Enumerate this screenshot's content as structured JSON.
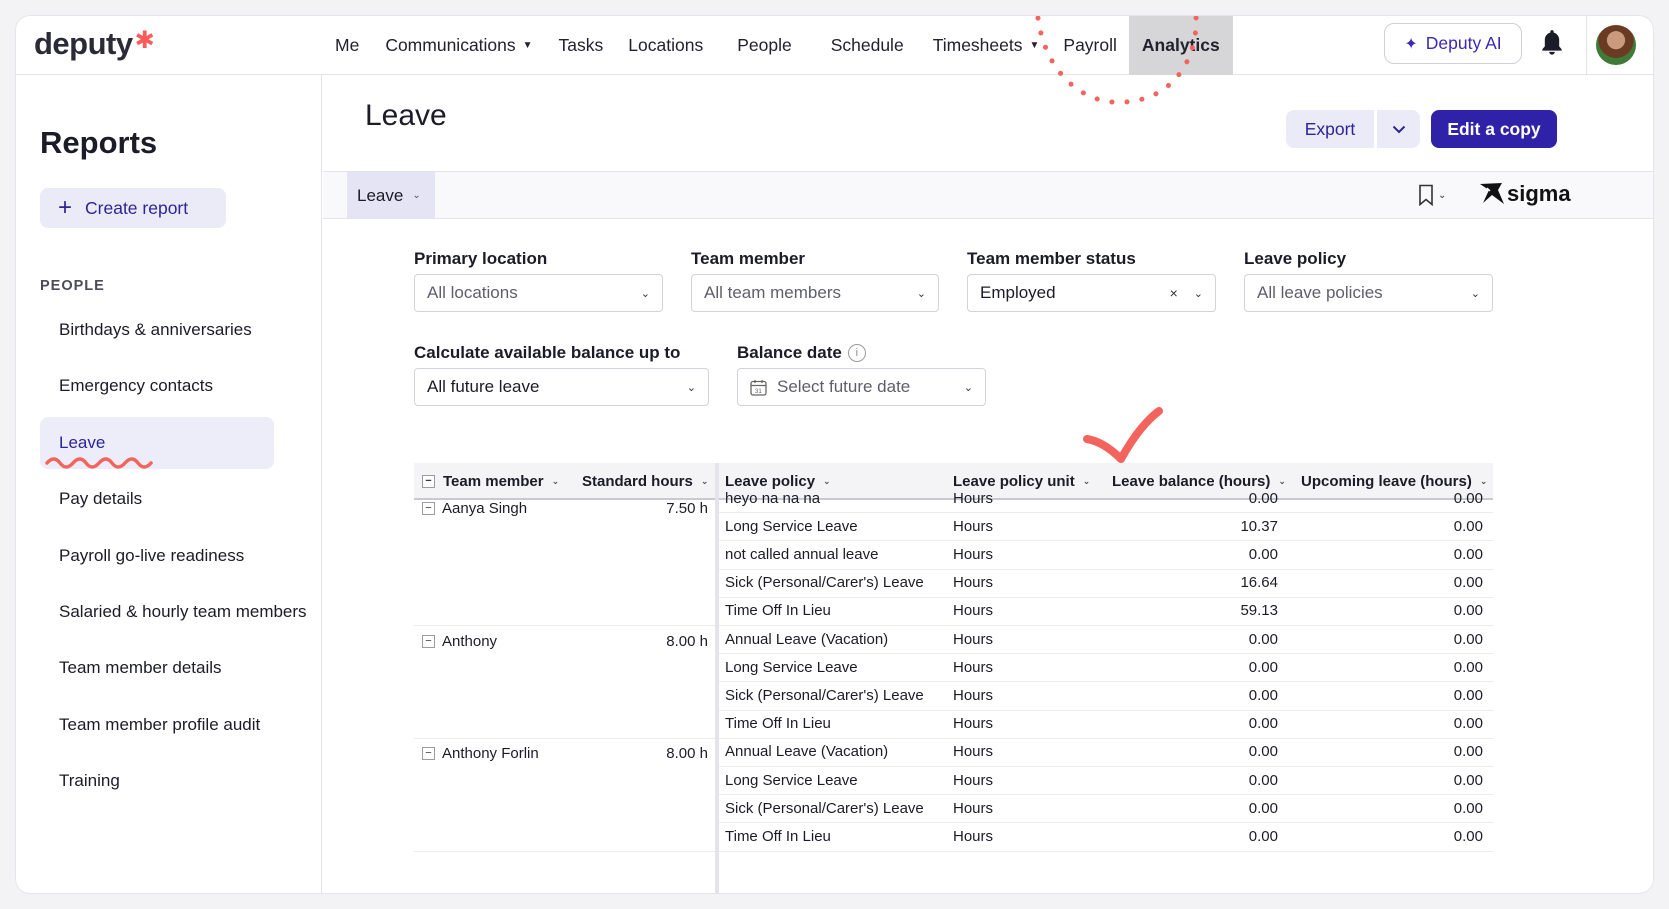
{
  "brand": {
    "logo_text": "deputy",
    "logo_mark": "✱"
  },
  "nav": {
    "items": [
      {
        "label": "Me",
        "caret": false,
        "active": false
      },
      {
        "label": "Communications",
        "caret": true,
        "active": false
      },
      {
        "label": "Tasks",
        "caret": false,
        "active": false
      },
      {
        "label": "Locations",
        "caret": false,
        "active": false
      },
      {
        "label": "People",
        "caret": false,
        "active": false
      },
      {
        "label": "Schedule",
        "caret": false,
        "active": false
      },
      {
        "label": "Timesheets",
        "caret": true,
        "active": false
      },
      {
        "label": "Payroll",
        "caret": false,
        "active": false
      },
      {
        "label": "Analytics",
        "caret": false,
        "active": true
      }
    ],
    "ai_button": "Deputy AI"
  },
  "sidebar": {
    "title": "Reports",
    "create_button": "Create report",
    "section": "PEOPLE",
    "items": [
      {
        "label": "Birthdays & anniversaries"
      },
      {
        "label": "Emergency contacts"
      },
      {
        "label": "Leave",
        "active": true
      },
      {
        "label": "Pay details"
      },
      {
        "label": "Payroll go-live readiness"
      },
      {
        "label": "Salaried & hourly team members"
      },
      {
        "label": "Team member details"
      },
      {
        "label": "Team member profile audit"
      },
      {
        "label": "Training"
      }
    ]
  },
  "page": {
    "title": "Leave",
    "export_button": "Export",
    "edit_button": "Edit a copy",
    "embed_tab": "Leave",
    "embed_brand": "sigma"
  },
  "filters": {
    "primary_location": {
      "label": "Primary location",
      "value": "All locations"
    },
    "team_member": {
      "label": "Team member",
      "value": "All team members"
    },
    "team_member_status": {
      "label": "Team member status",
      "value": "Employed"
    },
    "leave_policy": {
      "label": "Leave policy",
      "value": "All leave policies"
    },
    "calc_balance": {
      "label": "Calculate available balance up to",
      "value": "All future leave"
    },
    "balance_date": {
      "label": "Balance date",
      "placeholder": "Select future date"
    }
  },
  "table": {
    "headers": {
      "team_member": "Team member",
      "standard_hours": "Standard hours",
      "leave_policy": "Leave policy",
      "leave_policy_unit": "Leave policy unit",
      "leave_balance": "Leave balance (hours)",
      "upcoming_leave": "Upcoming leave (hours)"
    },
    "groups": [
      {
        "member": "Aanya Singh",
        "standard_hours": "7.50 h",
        "rows": [
          {
            "policy": "heyo na na na",
            "unit": "Hours",
            "balance": "0.00",
            "upcoming": "0.00"
          },
          {
            "policy": "Long Service Leave",
            "unit": "Hours",
            "balance": "10.37",
            "upcoming": "0.00"
          },
          {
            "policy": "not called annual leave",
            "unit": "Hours",
            "balance": "0.00",
            "upcoming": "0.00"
          },
          {
            "policy": "Sick (Personal/Carer's) Leave",
            "unit": "Hours",
            "balance": "16.64",
            "upcoming": "0.00"
          },
          {
            "policy": "Time Off In Lieu",
            "unit": "Hours",
            "balance": "59.13",
            "upcoming": "0.00"
          }
        ]
      },
      {
        "member": "Anthony",
        "standard_hours": "8.00 h",
        "rows": [
          {
            "policy": "Annual Leave (Vacation)",
            "unit": "Hours",
            "balance": "0.00",
            "upcoming": "0.00"
          },
          {
            "policy": "Long Service Leave",
            "unit": "Hours",
            "balance": "0.00",
            "upcoming": "0.00"
          },
          {
            "policy": "Sick (Personal/Carer's) Leave",
            "unit": "Hours",
            "balance": "0.00",
            "upcoming": "0.00"
          },
          {
            "policy": "Time Off In Lieu",
            "unit": "Hours",
            "balance": "0.00",
            "upcoming": "0.00"
          }
        ]
      },
      {
        "member": "Anthony Forlin",
        "standard_hours": "8.00 h",
        "rows": [
          {
            "policy": "Annual Leave (Vacation)",
            "unit": "Hours",
            "balance": "0.00",
            "upcoming": "0.00"
          },
          {
            "policy": "Long Service Leave",
            "unit": "Hours",
            "balance": "0.00",
            "upcoming": "0.00"
          },
          {
            "policy": "Sick (Personal/Carer's) Leave",
            "unit": "Hours",
            "balance": "0.00",
            "upcoming": "0.00"
          },
          {
            "policy": "Time Off In Lieu",
            "unit": "Hours",
            "balance": "0.00",
            "upcoming": "0.00"
          }
        ]
      }
    ]
  },
  "colors": {
    "accent": "#2f22a8",
    "annotation": "#f4645f",
    "active_nav": "#d6d6d9"
  }
}
